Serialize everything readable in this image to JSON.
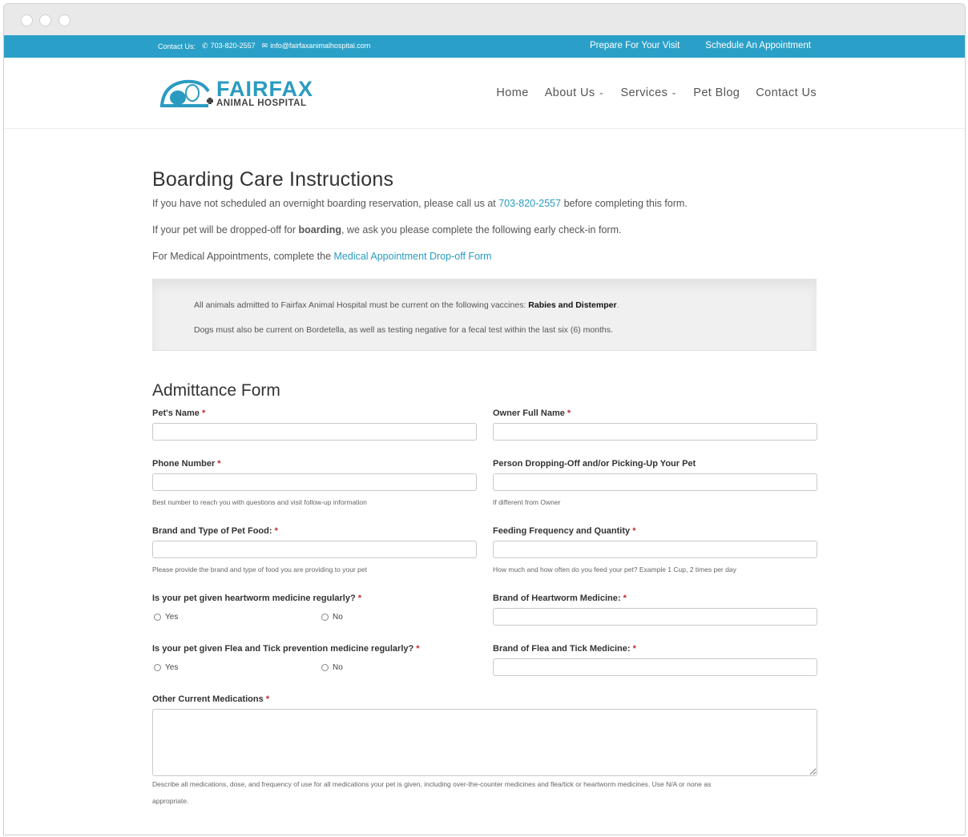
{
  "topbar": {
    "contact_label": "Contact Us:",
    "phone": "703-820-2557",
    "email": "info@fairfaxanimalhospital.com",
    "links": [
      "Prepare For Your Visit",
      "Schedule An Appointment"
    ]
  },
  "logo": {
    "line1": "FAIRFAX",
    "line2": "ANIMAL HOSPITAL"
  },
  "nav": [
    {
      "label": "Home"
    },
    {
      "label": "About Us"
    },
    {
      "label": "Services"
    },
    {
      "label": "Pet Blog"
    },
    {
      "label": "Contact Us"
    }
  ],
  "page": {
    "title": "Boarding Care Instructions",
    "intro1_pre": "If you have not scheduled an overnight boarding reservation, please call us at ",
    "intro1_link": "703-820-2557",
    "intro1_post": " before completing this form.",
    "intro2_pre": "If your pet will be dropped-off for ",
    "intro2_bold": "boarding",
    "intro2_post": ", we ask you please complete the following early check-in form.",
    "intro3_pre": "For Medical Appointments, complete the ",
    "intro3_link": "Medical Appointment Drop-off Form"
  },
  "notice": {
    "line1_pre": "All animals admitted to Fairfax Animal Hospital must be current on the following vaccines: ",
    "line1_bold": "Rabies and Distemper",
    "line1_post": ".",
    "line2": "Dogs must also be current on Bordetella, as well as testing negative for a fecal test within the last six (6) months."
  },
  "form": {
    "title": "Admittance Form",
    "required_mark": "*",
    "pets_name": "Pet's Name",
    "owner_name": "Owner Full Name",
    "phone": "Phone Number",
    "phone_help": "Best number to reach you with questions and visit follow-up information",
    "person": "Person Dropping-Off and/or Picking-Up Your Pet",
    "person_help": "If different from Owner",
    "food": "Brand and Type of Pet Food:",
    "food_help": "Please provide the brand and type of food you are providing to your pet",
    "feeding": "Feeding Frequency and Quantity",
    "feeding_help": "How much and how often do you feed your pet? Example 1 Cup, 2 times per day",
    "heartworm_q": "Is your pet given heartworm medicine regularly?",
    "heartworm_brand": "Brand of Heartworm Medicine:",
    "flea_q": "Is your pet given Flea and Tick prevention medicine regularly?",
    "flea_brand": "Brand of Flea and Tick Medicine:",
    "yes": "Yes",
    "no": "No",
    "meds": "Other Current Medications",
    "meds_help_1": "Describe all medications, dose, and frequency of use for all medications your pet is given, including over-the-counter medicines and flea/tick or heartworm medicines. Use N/A or none as",
    "meds_help_2": "appropriate."
  }
}
